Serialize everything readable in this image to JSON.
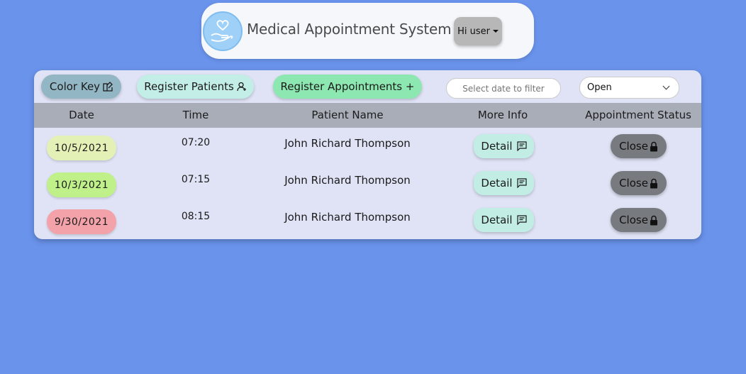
{
  "header": {
    "title": "Medical Appointment System",
    "user_label": "Hi user"
  },
  "toolbar": {
    "color_key": "Color Key",
    "register_patients": "Register Patients",
    "register_appointments": "Register Appointments +",
    "date_placeholder": "Select date to filter",
    "status_selected": "Open"
  },
  "table": {
    "columns": [
      "Date",
      "Time",
      "Patient Name",
      "More Info",
      "Appointment Status"
    ],
    "rows": [
      {
        "date": "10/5/2021",
        "time": "07:20",
        "name": "John Richard Thompson",
        "info": "Detail",
        "status": "Close",
        "date_color": "#e4f1b6"
      },
      {
        "date": "10/3/2021",
        "time": "07:15",
        "name": "John Richard Thompson",
        "info": "Detail",
        "status": "Close",
        "date_color": "#bff08a"
      },
      {
        "date": "9/30/2021",
        "time": "08:15",
        "name": "John Richard Thompson",
        "info": "Detail",
        "status": "Close",
        "date_color": "#f2a2a8"
      }
    ]
  },
  "icons": {
    "logo": "heart-hand-icon",
    "color_key": "palette-icon",
    "register_patients": "add-user-icon",
    "detail": "message-icon",
    "close": "lock-icon"
  },
  "colors": {
    "background": "#6a93ec",
    "register_appointments": "#8de7b0",
    "register_patients": "#c3eee8",
    "detail": "#c2ede4",
    "close": "#777a7e"
  }
}
